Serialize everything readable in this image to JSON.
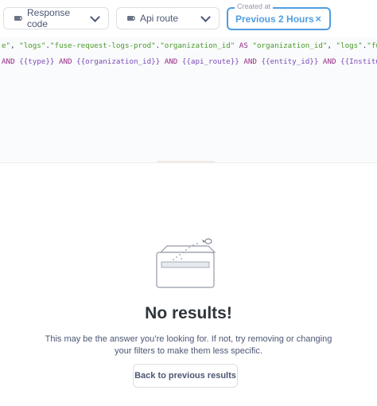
{
  "filters": {
    "response_code": {
      "label": "Response code",
      "icon": "tag-icon"
    },
    "api_route": {
      "label": "Api route",
      "icon": "tag-icon"
    },
    "created_at": {
      "legend": "Created at",
      "value": "Previous 2 Hours",
      "clear": "×"
    }
  },
  "sql": {
    "line1": [
      {
        "t": "e\"",
        "c": "str"
      },
      {
        "t": ", ",
        "c": "punc"
      },
      {
        "t": "\"logs\"",
        "c": "str"
      },
      {
        "t": ".",
        "c": "punc"
      },
      {
        "t": "\"fuse-request-logs-prod\"",
        "c": "str"
      },
      {
        "t": ".",
        "c": "punc"
      },
      {
        "t": "\"organization_id\"",
        "c": "str"
      },
      {
        "t": " AS ",
        "c": "kw"
      },
      {
        "t": "\"organization_id\"",
        "c": "str"
      },
      {
        "t": ", ",
        "c": "punc"
      },
      {
        "t": "\"logs\"",
        "c": "str"
      },
      {
        "t": ".",
        "c": "punc"
      },
      {
        "t": "\"fuse-rec",
        "c": "str"
      }
    ],
    "line2": [
      {
        "t": "AND ",
        "c": "kw"
      },
      {
        "t": "{{type}}",
        "c": "var"
      },
      {
        "t": " AND ",
        "c": "kw"
      },
      {
        "t": "{{organization_id}}",
        "c": "var"
      },
      {
        "t": " AND ",
        "c": "kw"
      },
      {
        "t": "{{api_route}}",
        "c": "var"
      },
      {
        "t": " AND ",
        "c": "kw"
      },
      {
        "t": "{{entity_id}}",
        "c": "var"
      },
      {
        "t": " AND ",
        "c": "kw"
      },
      {
        "t": "{{Institution_r",
        "c": "var"
      }
    ]
  },
  "empty_state": {
    "icon": "empty-box-icon",
    "title": "No results!",
    "message": "This may be the answer you’re looking for. If not, try removing or changing your filters to make them less specific.",
    "button": "Back to previous results"
  },
  "colors": {
    "accent": "#509ee3",
    "string": "#4c9a2a",
    "keyword": "#9a2a86",
    "variable": "#7d4ab8",
    "text_dark": "#2e353b",
    "text": "#4c5773"
  }
}
